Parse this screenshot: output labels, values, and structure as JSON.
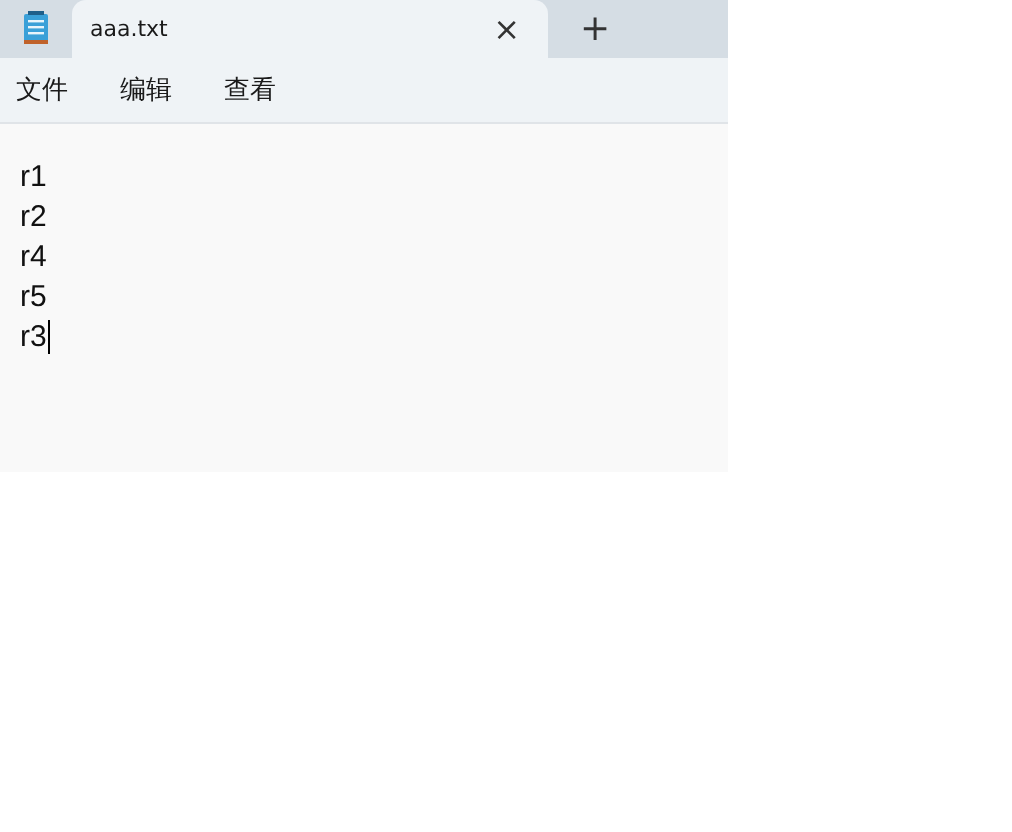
{
  "tabs": [
    {
      "title": "aaa.txt",
      "close": "×",
      "selected": true
    }
  ],
  "new_tab": "+",
  "menu": [
    "文件",
    "编辑",
    "查看"
  ],
  "editor": {
    "lines": [
      "r1",
      "r2",
      "r4",
      "r5",
      "r3"
    ]
  }
}
